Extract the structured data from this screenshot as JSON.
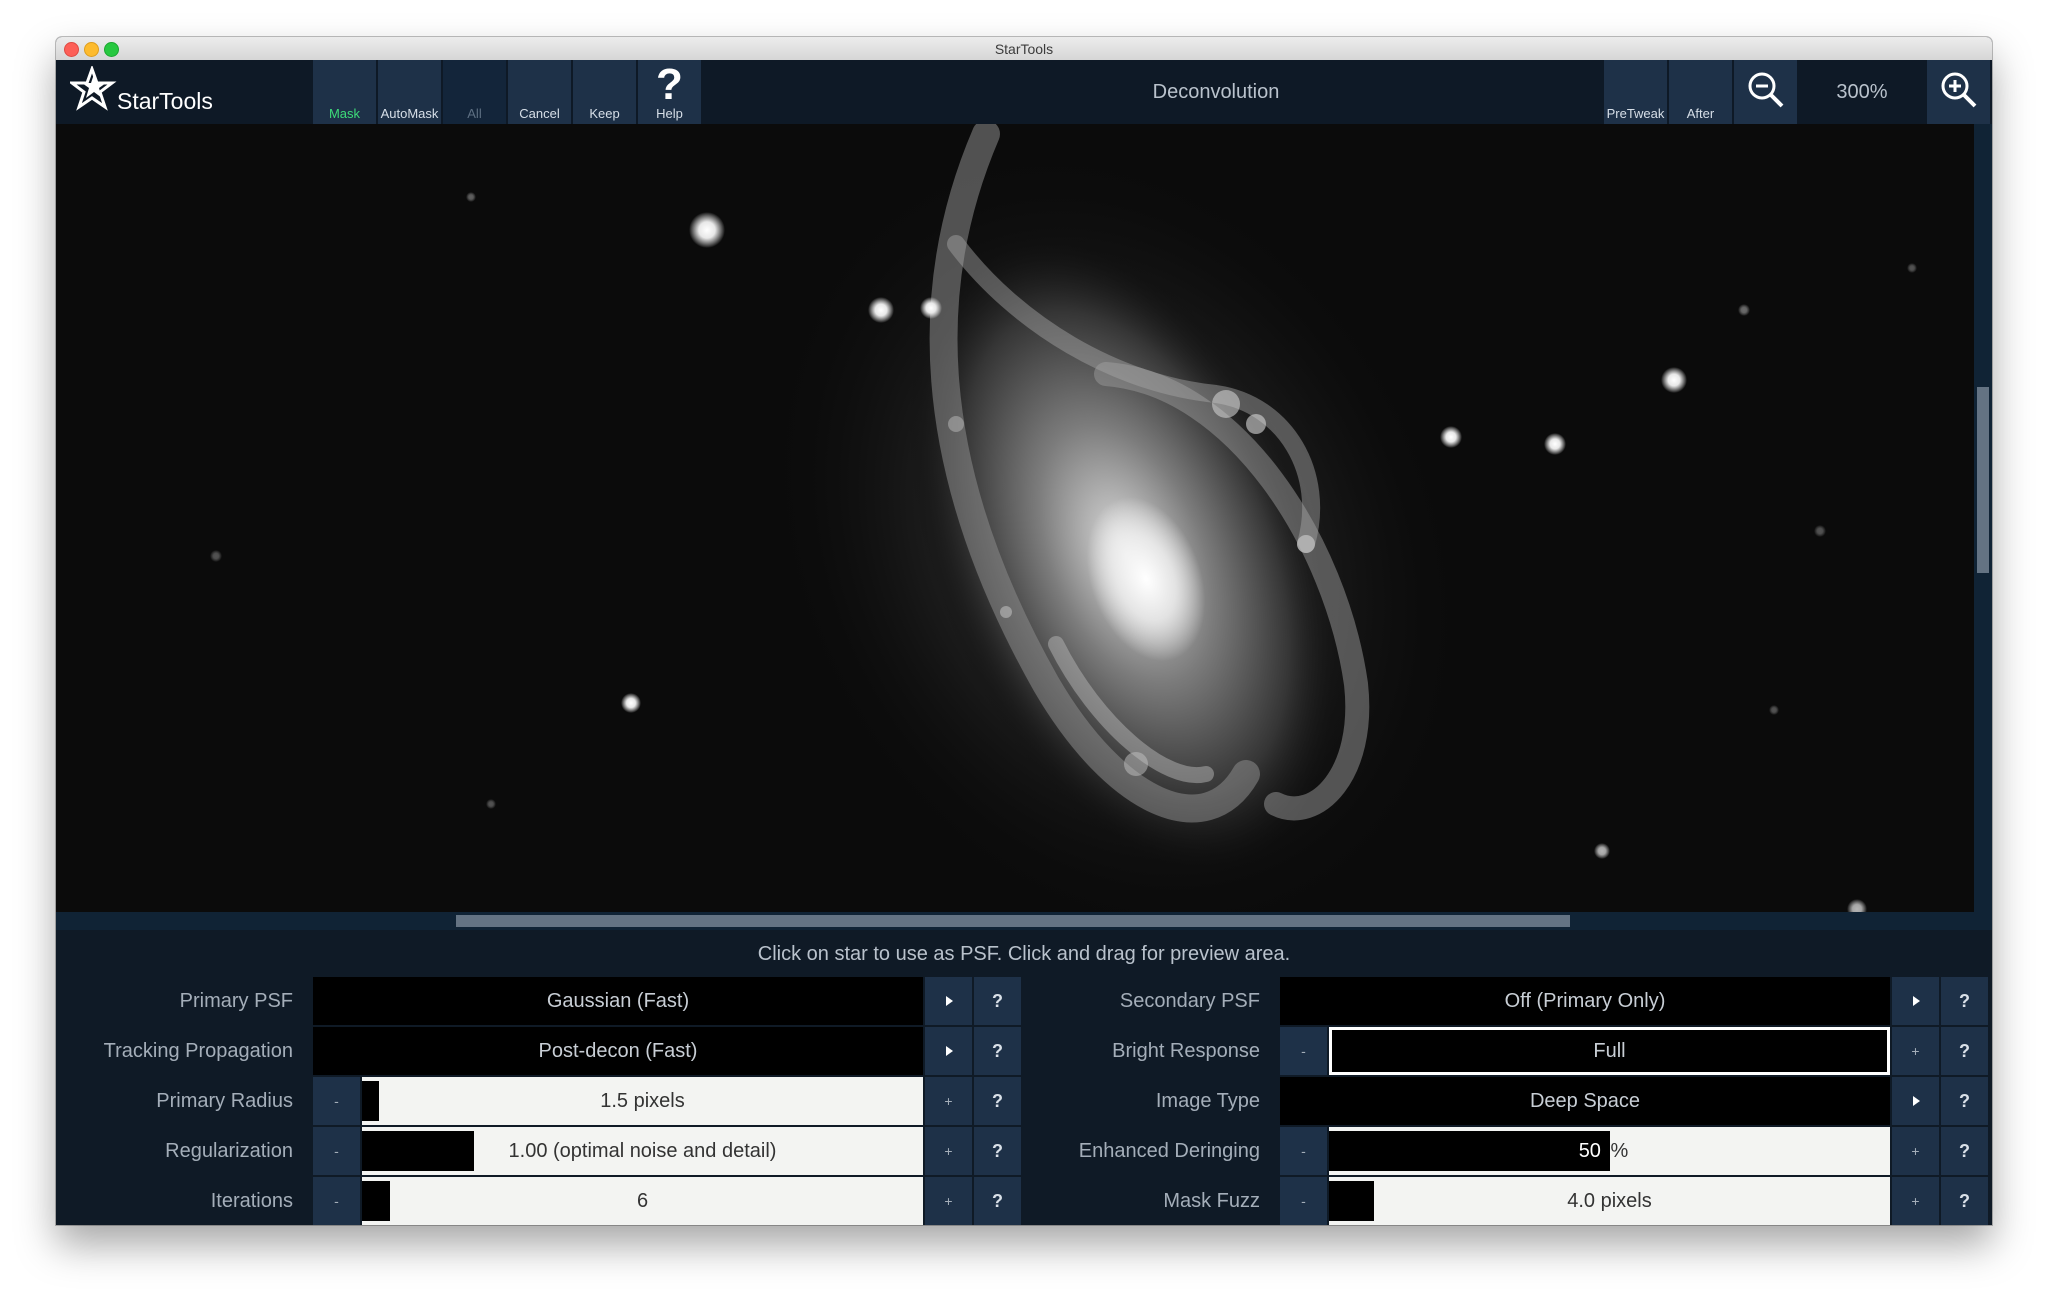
{
  "window": {
    "title": "StarTools"
  },
  "logo": {
    "text": "StarTools"
  },
  "toolbar": {
    "left_buttons": [
      {
        "label": "Mask"
      },
      {
        "label": "AutoMask"
      },
      {
        "label": "All"
      },
      {
        "label": "Cancel"
      },
      {
        "label": "Keep"
      },
      {
        "label": "Help",
        "icon": "question-mark-icon"
      }
    ],
    "module_title": "Deconvolution",
    "right_buttons": [
      {
        "label": "PreTweak"
      },
      {
        "label": "After"
      }
    ],
    "zoom_level": "300%",
    "zoom_out_icon": "zoom-out-icon",
    "zoom_in_icon": "zoom-in-icon"
  },
  "hint": "Click on star to use as PSF. Click and drag for preview area.",
  "params": {
    "left": [
      {
        "label": "Primary PSF",
        "type": "select",
        "value": "Gaussian (Fast)"
      },
      {
        "label": "Tracking Propagation",
        "type": "select",
        "value": "Post-decon (Fast)"
      },
      {
        "label": "Primary Radius",
        "type": "slider",
        "value": "1.5 pixels",
        "fraction": 0.03,
        "minus": "-",
        "plus": "+"
      },
      {
        "label": "Regularization",
        "type": "slider",
        "value": "1.00 (optimal noise and detail)",
        "fraction": 0.2,
        "minus": "-",
        "plus": "+"
      },
      {
        "label": "Iterations",
        "type": "slider",
        "value": "6",
        "fraction": 0.05,
        "minus": "-",
        "plus": "+"
      }
    ],
    "right": [
      {
        "label": "Secondary PSF",
        "type": "select",
        "value": "Off (Primary Only)"
      },
      {
        "label": "Bright Response",
        "type": "toggle",
        "value": "Full",
        "minus": "-",
        "plus": "+"
      },
      {
        "label": "Image Type",
        "type": "select",
        "value": "Deep Space"
      },
      {
        "label": "Enhanced Deringing",
        "type": "slider",
        "value": "50",
        "unit": "%",
        "fraction": 0.5,
        "minus": "-",
        "plus": "+"
      },
      {
        "label": "Mask Fuzz",
        "type": "slider",
        "value": "4.0 pixels",
        "fraction": 0.08,
        "minus": "-",
        "plus": "+"
      }
    ],
    "help_label": "?"
  },
  "colors": {
    "panel_bg": "#0f1a26",
    "button_bg": "#1e3148",
    "mask_active": "#3ddc79"
  }
}
